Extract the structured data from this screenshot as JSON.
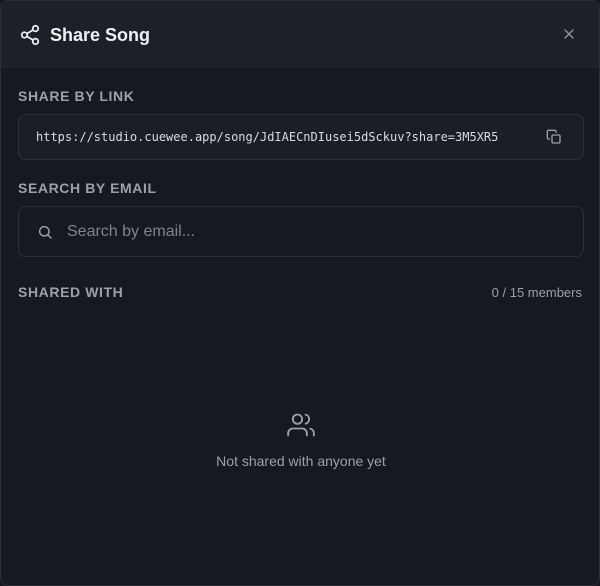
{
  "dialog": {
    "title": "Share Song",
    "header_icon": "share-icon",
    "close_icon": "close-icon"
  },
  "share_by_link": {
    "label": "SHARE BY LINK",
    "url": "https://studio.cuewee.app/song/JdIAECnDIusei5dSckuv?share=3M5XR5",
    "copy_icon": "copy-icon"
  },
  "search_by_email": {
    "label": "SEARCH BY EMAIL",
    "placeholder": "Search by email...",
    "value": "",
    "icon": "search-icon"
  },
  "shared_with": {
    "label": "SHARED WITH",
    "count_text": "0 / 15 members",
    "empty_icon": "users-icon",
    "empty_message": "Not shared with anyone yet"
  },
  "colors": {
    "background": "#16191f",
    "header_background": "#1d2028",
    "border": "#2c3038",
    "text_primary": "#eef0f3",
    "text_muted": "#9ba1ab"
  }
}
